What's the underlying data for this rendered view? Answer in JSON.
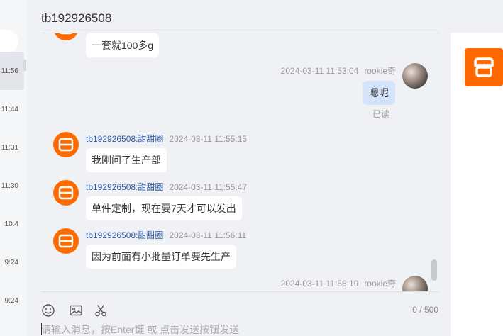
{
  "sidebar": {
    "times": [
      {
        "label": "11:56",
        "selected": true
      },
      {
        "label": "11:44",
        "selected": false
      },
      {
        "label": "11:31",
        "selected": false
      },
      {
        "label": "11:30",
        "selected": false
      },
      {
        "label": "10:4",
        "selected": false
      },
      {
        "label": "9:24",
        "selected": false
      },
      {
        "label": "9:24",
        "selected": false
      }
    ]
  },
  "chat": {
    "title": "tb192926508",
    "messages": [
      {
        "side": "left",
        "text": "一套就100多g"
      },
      {
        "side": "right",
        "time": "2024-03-11 11:53:04",
        "nick": "rookie奇",
        "text": "嗯呢",
        "status": "已读"
      },
      {
        "side": "left",
        "nick": "tb192926508:甜甜圈",
        "time": "2024-03-11 11:55:15",
        "text": "我刚问了生产部"
      },
      {
        "side": "left",
        "nick": "tb192926508:甜甜圈",
        "time": "2024-03-11 11:55:47",
        "text": "单件定制，现在要7天才可以发出"
      },
      {
        "side": "left",
        "nick": "tb192926508:甜甜圈",
        "time": "2024-03-11 11:56:11",
        "text": "因为前面有小批量订单要先生产"
      },
      {
        "side": "right",
        "time": "2024-03-11 11:56:19",
        "nick": "rookie奇"
      }
    ]
  },
  "toolbar": {
    "icons": [
      "emoji-icon",
      "image-icon",
      "scissors-icon"
    ],
    "counter": "0 / 500"
  },
  "input": {
    "placeholder": "请输入消息，按Enter键 或 点击发送按钮发送"
  },
  "colors": {
    "brand": "#ff6a00",
    "nick": "#2f5ea8",
    "my_bubble": "#d4e4fb"
  }
}
